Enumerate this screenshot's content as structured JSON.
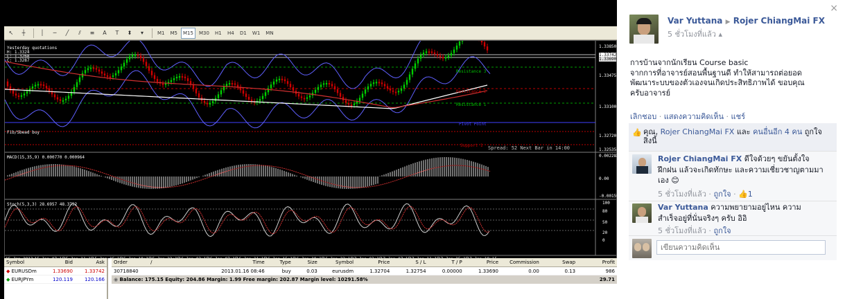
{
  "mt4": {
    "toolbar": {
      "timeframes": [
        "M1",
        "M5",
        "M15",
        "M30",
        "H1",
        "H4",
        "D1",
        "W1",
        "MN"
      ],
      "selected": "M15"
    },
    "main_chart": {
      "label_top": "Yesterday quotations",
      "label_prices": [
        "H: 1.3324",
        "L: 1.3268",
        "C: 1.3287"
      ],
      "label_left": "Fib/Sbead buy",
      "resistance_3": "Resistance 3",
      "resistance_2": "Resistance 2",
      "resistance_1": "Resistance 1",
      "pivot": "Pivot Point",
      "support_1": "Support 1",
      "spread": "Spread: 52  Next Bar in 14:00",
      "price_axis": [
        "1.33850",
        "1.33742",
        "1.33690",
        "1.33475",
        "1.33100",
        "1.32720",
        "1.32535"
      ]
    },
    "macd": {
      "label": "MACD(15,35,9) 0.000770 0.000964",
      "axis": [
        "0.002283",
        "0.00",
        "-0.001597"
      ]
    },
    "stoch": {
      "label": "Stoch(5,3,3) 28.6957 48.3752",
      "axis": [
        "100",
        "80",
        "50",
        "20",
        "0"
      ]
    },
    "time_axis": [
      "15 Jan 2013",
      "15 Jan 07:15",
      "15 Jan 11:15",
      "15 Jan 15:15",
      "15 Jan 19:15",
      "15 Jan 23:15",
      "16 Jan 03:15",
      "16 Jan 07:15",
      "16 Jan 11:15",
      "16 Jan 15:15",
      "16 Jan 19:15",
      "16 Jan 23:15",
      "17 Jan 03:15",
      "17 Jan 07:15",
      "17 Jan 11:15",
      "17 Jan 15:15",
      "17 Jan 19:15"
    ],
    "chart_tabs": [
      "EURUSDm,M5",
      "EURUSDm,M15",
      "EURUSDm,M15",
      "EURUSDm,H1"
    ],
    "market_watch": {
      "headers": [
        "Symbol",
        "Bid",
        "Ask"
      ],
      "rows": [
        {
          "symbol": "EURUSDm",
          "bid": "1.33690",
          "ask": "1.33742"
        },
        {
          "symbol": "EURJPYm",
          "bid": "120.119",
          "ask": "120.166"
        }
      ]
    },
    "trade": {
      "headers": [
        "Order",
        "/",
        "Time",
        "Type",
        "Size",
        "Symbol",
        "Price",
        "S / L",
        "T / P",
        "Price",
        "Commission",
        "Swap",
        "Profit"
      ],
      "row": [
        "30718840",
        "",
        "2013.01.16 08:46",
        "buy",
        "0.03",
        "eurusdm",
        "1.32704",
        "1.32754",
        "0.00000",
        "1.33690",
        "0.00",
        "0.13",
        "986"
      ],
      "balance": "Balance: 175.15  Equity: 204.86  Margin: 1.99  Free margin: 202.87  Margin level: 10291.58%",
      "balance_profit": "29.71"
    }
  },
  "facebook": {
    "author": "Var Yuttana",
    "target": "Rojer ChiangMai FX",
    "time": "5 ชั่วโมงที่แล้ว",
    "post_text": "การบ้านจากนักเรียน Course basic\nจากการที่อาจารย์สอนพื้นฐานดี ทำให้สามารถต่อยอด\nพัฒนาระบบของตัวเองจนเกิดประสิทธิภาพได้ ขอบคุณ\nครับอาจารย์",
    "actions": [
      "เลิกชอบ",
      "แสดงความคิดเห็น",
      "แชร์"
    ],
    "likes_prefix": "คุณ, ",
    "likes_link1": "Rojer ChiangMai FX",
    "likes_mid": " และ ",
    "likes_link2": "คนอื่นอีก 4 คน",
    "likes_suffix": " ถูกใจ",
    "likes_line2": "สิ่งนี้",
    "comments": [
      {
        "author": "Rojer ChiangMai FX",
        "text1": " ดีใจด้วยๆ ขยันตั้งใจ",
        "text2": "ฝึกฝน แล้วจะเกิดทักษะ และความเชี่ยวชาญตามมา",
        "text3": "เอง 😊",
        "time": "5 ชั่วโมงที่แล้ว",
        "like": "ถูกใจ",
        "likes": "1"
      },
      {
        "author": "Var Yuttana",
        "text1": " ความพยายามอยู่ไหน ความ",
        "text2": "สำเร็จอยู่ที่นั่นจริงๆ ครับ อิอิ",
        "time": "5 ชั่วโมงที่แล้ว",
        "like": "ถูกใจ"
      }
    ],
    "comment_placeholder": "เขียนความคิดเห็น",
    "close": "×"
  }
}
